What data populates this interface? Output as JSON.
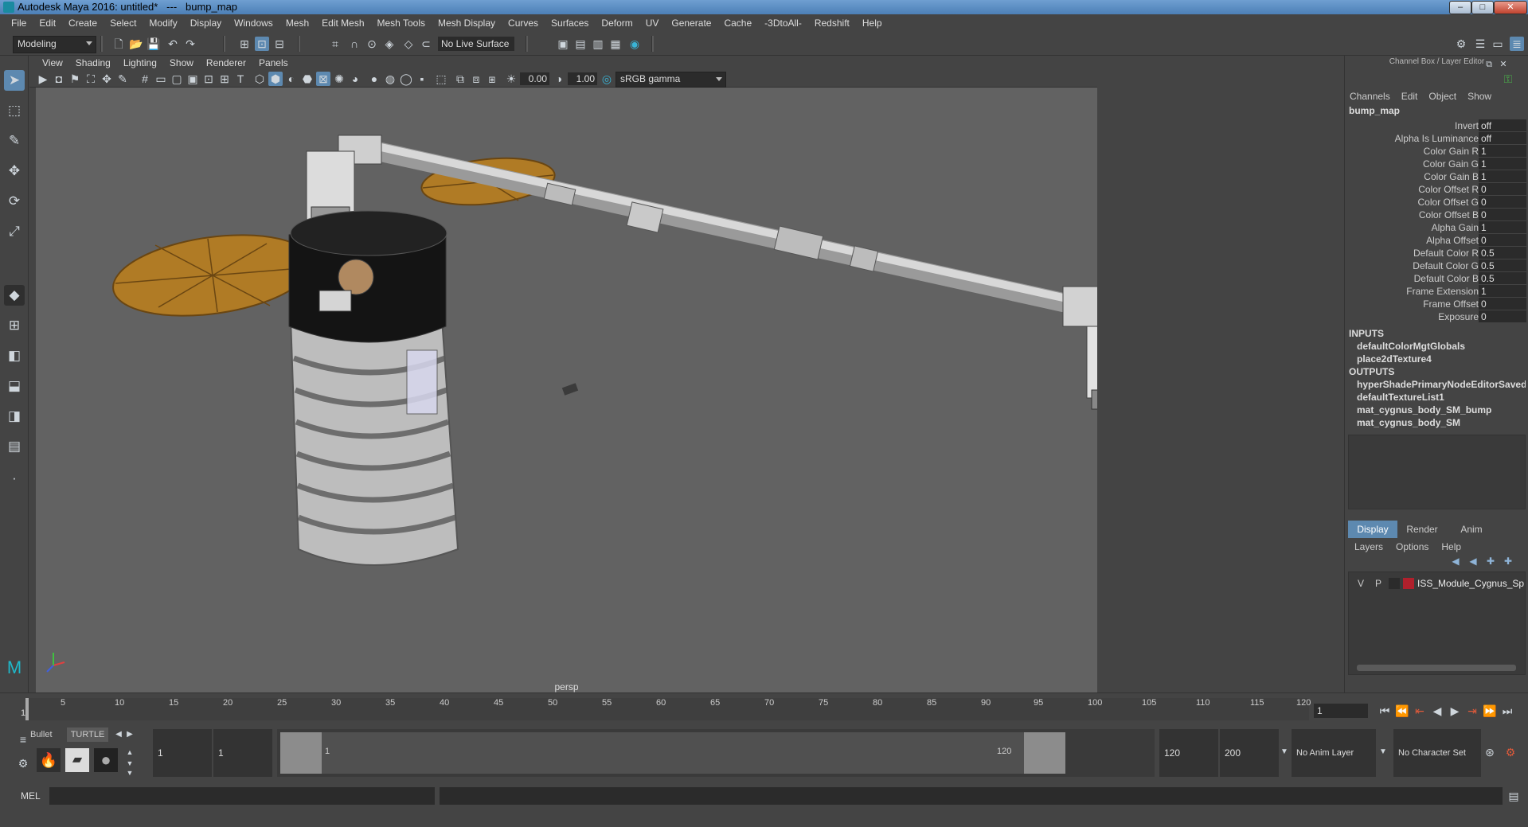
{
  "window": {
    "title": "Autodesk Maya 2016: untitled*   ---   bump_map",
    "minimize": "–",
    "maximize": "□",
    "close": "✕"
  },
  "menubar": [
    "File",
    "Edit",
    "Create",
    "Select",
    "Modify",
    "Display",
    "Windows",
    "Mesh",
    "Edit Mesh",
    "Mesh Tools",
    "Mesh Display",
    "Curves",
    "Surfaces",
    "Deform",
    "UV",
    "Generate",
    "Cache",
    "-3DtoAll-",
    "Redshift",
    "Help"
  ],
  "statusline": {
    "mode": "Modeling",
    "live_surface": "No Live Surface"
  },
  "viewport": {
    "menu": [
      "View",
      "Shading",
      "Lighting",
      "Show",
      "Renderer",
      "Panels"
    ],
    "exposure": "0.00",
    "gamma": "1.00",
    "color_space": "sRGB gamma",
    "camera_label": "persp"
  },
  "channel_box": {
    "panel_title": "Channel Box / Layer Editor",
    "menu": [
      "Channels",
      "Edit",
      "Object",
      "Show"
    ],
    "node_name": "bump_map",
    "attributes": [
      {
        "name": "Invert",
        "value": "off"
      },
      {
        "name": "Alpha Is Luminance",
        "value": "off"
      },
      {
        "name": "Color Gain R",
        "value": "1"
      },
      {
        "name": "Color Gain G",
        "value": "1"
      },
      {
        "name": "Color Gain B",
        "value": "1"
      },
      {
        "name": "Color Offset R",
        "value": "0"
      },
      {
        "name": "Color Offset G",
        "value": "0"
      },
      {
        "name": "Color Offset B",
        "value": "0"
      },
      {
        "name": "Alpha Gain",
        "value": "1"
      },
      {
        "name": "Alpha Offset",
        "value": "0"
      },
      {
        "name": "Default Color R",
        "value": "0.5"
      },
      {
        "name": "Default Color G",
        "value": "0.5"
      },
      {
        "name": "Default Color B",
        "value": "0.5"
      },
      {
        "name": "Frame Extension",
        "value": "1"
      },
      {
        "name": "Frame Offset",
        "value": "0"
      },
      {
        "name": "Exposure",
        "value": "0"
      }
    ],
    "inputs_label": "INPUTS",
    "inputs": [
      "defaultColorMgtGlobals",
      "place2dTexture4"
    ],
    "outputs_label": "OUTPUTS",
    "outputs": [
      "hyperShadePrimaryNodeEditorSavedT...",
      "defaultTextureList1",
      "mat_cygnus_body_SM_bump",
      "mat_cygnus_body_SM"
    ]
  },
  "layer_editor": {
    "tabs": [
      "Display",
      "Render",
      "Anim"
    ],
    "menu": [
      "Layers",
      "Options",
      "Help"
    ],
    "layer": {
      "v": "V",
      "p": "P",
      "name": "ISS_Module_Cygnus_Spa",
      "color": "#b0202c"
    }
  },
  "time_slider": {
    "ticks": [
      "5",
      "10",
      "15",
      "20",
      "25",
      "30",
      "35",
      "40",
      "45",
      "50",
      "55",
      "60",
      "65",
      "70",
      "75",
      "80",
      "85",
      "90",
      "95",
      "100",
      "105",
      "110",
      "115",
      "120"
    ],
    "start_label": "1",
    "current_frame": "1"
  },
  "range_slider": {
    "shelf_tabs": [
      "Bullet",
      "TURTLE"
    ],
    "start_time": "1",
    "playback_start": "1",
    "range_start_label": "1",
    "range_end_label": "120",
    "playback_end": "120",
    "end_time": "200",
    "anim_layer": "No Anim Layer",
    "character_set": "No Character Set"
  },
  "command_line": {
    "label": "MEL"
  }
}
